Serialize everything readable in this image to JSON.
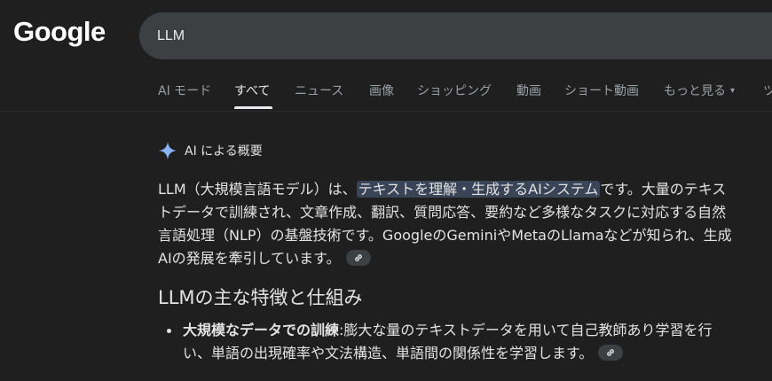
{
  "header": {
    "logo": "Google",
    "search": {
      "value": "LLM"
    }
  },
  "tabs": [
    {
      "label": "AI モード",
      "active": false
    },
    {
      "label": "すべて",
      "active": true
    },
    {
      "label": "ニュース",
      "active": false
    },
    {
      "label": "画像",
      "active": false
    },
    {
      "label": "ショッピング",
      "active": false
    },
    {
      "label": "動画",
      "active": false
    },
    {
      "label": "ショート動画",
      "active": false
    },
    {
      "label": "もっと見る",
      "active": false
    },
    {
      "label": "ツ",
      "active": false
    }
  ],
  "ai_overview": {
    "title": "AI による概要",
    "para_before": "LLM（大規模言語モデル）は、",
    "para_highlight": "テキストを理解・生成するAIシステム",
    "para_after": "です。大量のテキストデータで訓練され、文章作成、翻訳、質問応答、要約など多様なタスクに対応する自然言語処理（NLP）の基盤技術です。GoogleのGeminiやMetaのLlamaなどが知られ、生成AIの発展を牽引しています。",
    "section_title": "LLMの主な特徴と仕組み",
    "bullets": [
      {
        "bold": "大規模なデータでの訓練",
        "text": ":膨大な量のテキストデータを用いて自己教師あり学習を行い、単語の出現確率や文法構造、単語間の関係性を学習します。"
      }
    ]
  },
  "colors": {
    "background": "#1f1f1f",
    "search_box": "#3c4043",
    "highlight": "#394457",
    "sparkle": "#8ab4f8"
  }
}
